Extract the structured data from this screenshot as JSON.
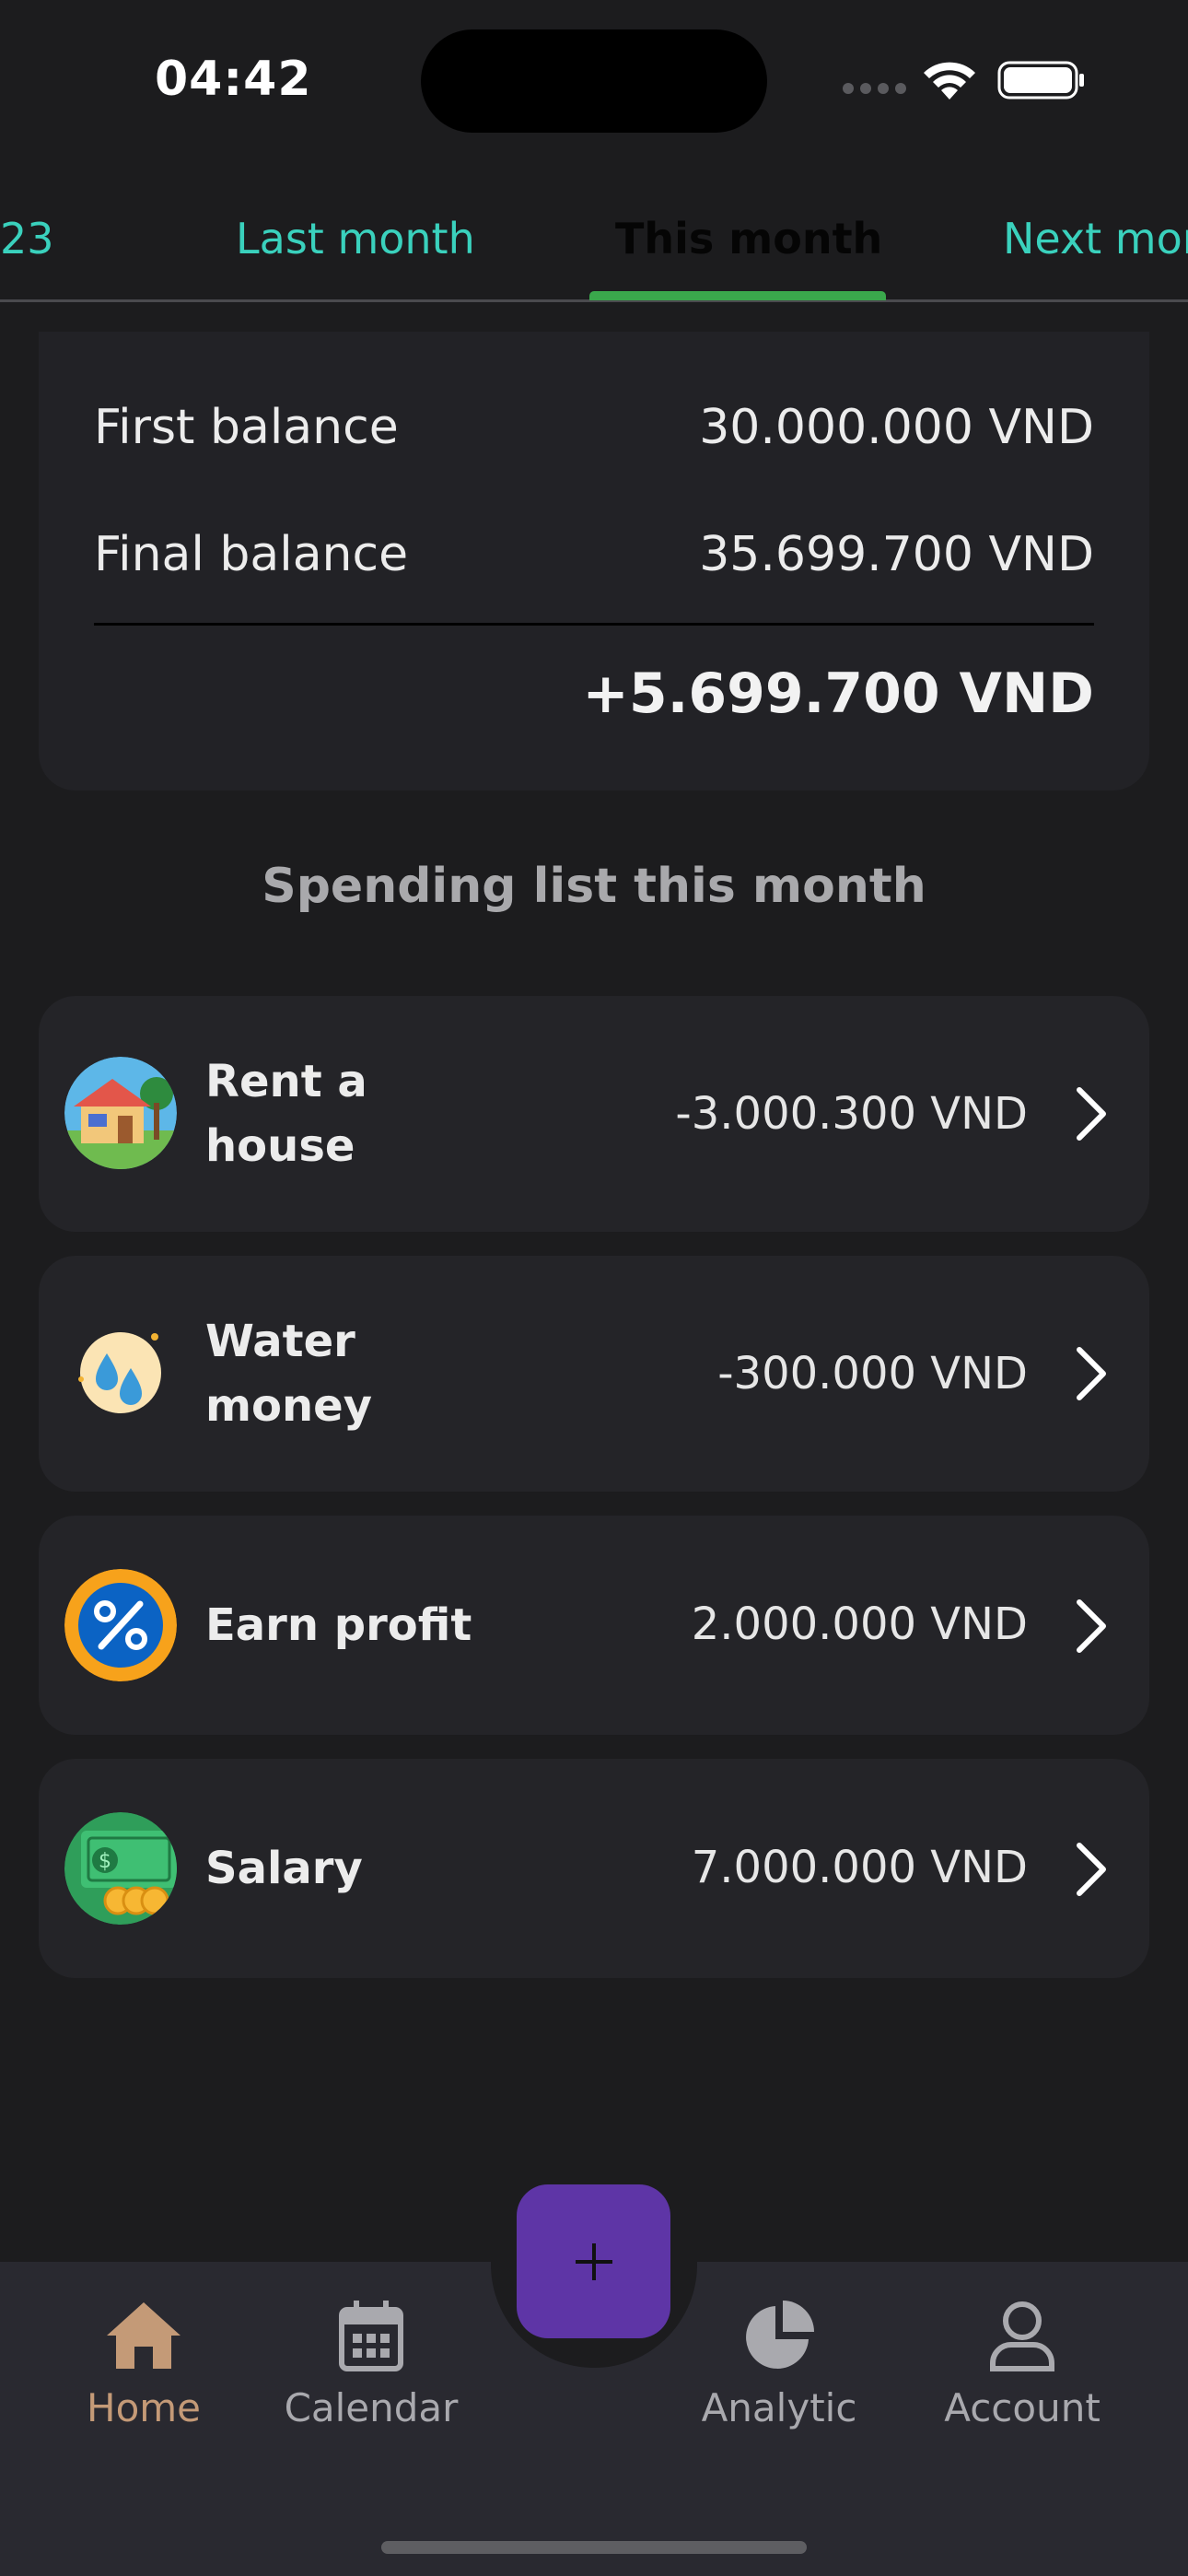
{
  "status_bar": {
    "time": "04:42"
  },
  "tabs": [
    {
      "label": "23",
      "active": false
    },
    {
      "label": "Last month",
      "active": false
    },
    {
      "label": "This month",
      "active": true
    },
    {
      "label": "Next month",
      "active": false
    }
  ],
  "balance": {
    "first_label": "First balance",
    "first_value": "30.000.000 VND",
    "final_label": "Final balance",
    "final_value": "35.699.700 VND",
    "difference": "+5.699.700 VND"
  },
  "section_title": "Spending list this month",
  "spending": [
    {
      "name_line1": "Rent a",
      "name_line2": "house",
      "amount": "-3.000.300 VND",
      "icon": "house-icon"
    },
    {
      "name_line1": "Water",
      "name_line2": "money",
      "amount": "-300.000 VND",
      "icon": "water-drops-icon"
    },
    {
      "name": "Earn profit",
      "amount": "2.000.000 VND",
      "icon": "percent-badge-icon"
    },
    {
      "name": "Salary",
      "amount": "7.000.000 VND",
      "icon": "money-coins-icon"
    }
  ],
  "nav": {
    "home": "Home",
    "calendar": "Calendar",
    "analytic": "Analytic",
    "account": "Account",
    "add": "+"
  },
  "colors": {
    "background": "#1c1c1e",
    "tab_text": "#3ad1bd",
    "tab_indicator": "#3aa84c",
    "fab": "#5e35a6",
    "nav_active": "#c49a77"
  }
}
